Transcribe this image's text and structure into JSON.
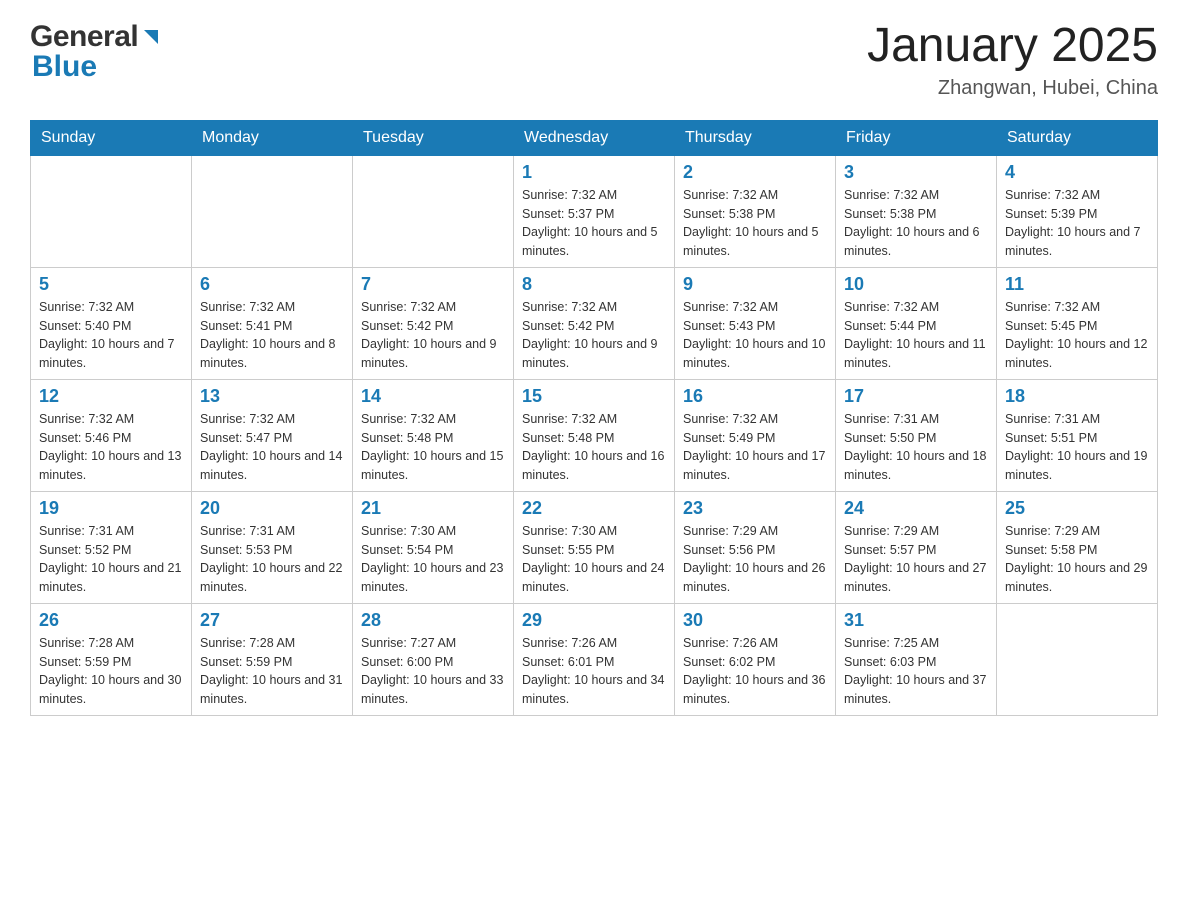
{
  "header": {
    "logo": {
      "general": "General",
      "blue": "Blue"
    },
    "title": "January 2025",
    "location": "Zhangwan, Hubei, China"
  },
  "calendar": {
    "days_of_week": [
      "Sunday",
      "Monday",
      "Tuesday",
      "Wednesday",
      "Thursday",
      "Friday",
      "Saturday"
    ],
    "weeks": [
      [
        {
          "day": "",
          "info": ""
        },
        {
          "day": "",
          "info": ""
        },
        {
          "day": "",
          "info": ""
        },
        {
          "day": "1",
          "info": "Sunrise: 7:32 AM\nSunset: 5:37 PM\nDaylight: 10 hours and 5 minutes."
        },
        {
          "day": "2",
          "info": "Sunrise: 7:32 AM\nSunset: 5:38 PM\nDaylight: 10 hours and 5 minutes."
        },
        {
          "day": "3",
          "info": "Sunrise: 7:32 AM\nSunset: 5:38 PM\nDaylight: 10 hours and 6 minutes."
        },
        {
          "day": "4",
          "info": "Sunrise: 7:32 AM\nSunset: 5:39 PM\nDaylight: 10 hours and 7 minutes."
        }
      ],
      [
        {
          "day": "5",
          "info": "Sunrise: 7:32 AM\nSunset: 5:40 PM\nDaylight: 10 hours and 7 minutes."
        },
        {
          "day": "6",
          "info": "Sunrise: 7:32 AM\nSunset: 5:41 PM\nDaylight: 10 hours and 8 minutes."
        },
        {
          "day": "7",
          "info": "Sunrise: 7:32 AM\nSunset: 5:42 PM\nDaylight: 10 hours and 9 minutes."
        },
        {
          "day": "8",
          "info": "Sunrise: 7:32 AM\nSunset: 5:42 PM\nDaylight: 10 hours and 9 minutes."
        },
        {
          "day": "9",
          "info": "Sunrise: 7:32 AM\nSunset: 5:43 PM\nDaylight: 10 hours and 10 minutes."
        },
        {
          "day": "10",
          "info": "Sunrise: 7:32 AM\nSunset: 5:44 PM\nDaylight: 10 hours and 11 minutes."
        },
        {
          "day": "11",
          "info": "Sunrise: 7:32 AM\nSunset: 5:45 PM\nDaylight: 10 hours and 12 minutes."
        }
      ],
      [
        {
          "day": "12",
          "info": "Sunrise: 7:32 AM\nSunset: 5:46 PM\nDaylight: 10 hours and 13 minutes."
        },
        {
          "day": "13",
          "info": "Sunrise: 7:32 AM\nSunset: 5:47 PM\nDaylight: 10 hours and 14 minutes."
        },
        {
          "day": "14",
          "info": "Sunrise: 7:32 AM\nSunset: 5:48 PM\nDaylight: 10 hours and 15 minutes."
        },
        {
          "day": "15",
          "info": "Sunrise: 7:32 AM\nSunset: 5:48 PM\nDaylight: 10 hours and 16 minutes."
        },
        {
          "day": "16",
          "info": "Sunrise: 7:32 AM\nSunset: 5:49 PM\nDaylight: 10 hours and 17 minutes."
        },
        {
          "day": "17",
          "info": "Sunrise: 7:31 AM\nSunset: 5:50 PM\nDaylight: 10 hours and 18 minutes."
        },
        {
          "day": "18",
          "info": "Sunrise: 7:31 AM\nSunset: 5:51 PM\nDaylight: 10 hours and 19 minutes."
        }
      ],
      [
        {
          "day": "19",
          "info": "Sunrise: 7:31 AM\nSunset: 5:52 PM\nDaylight: 10 hours and 21 minutes."
        },
        {
          "day": "20",
          "info": "Sunrise: 7:31 AM\nSunset: 5:53 PM\nDaylight: 10 hours and 22 minutes."
        },
        {
          "day": "21",
          "info": "Sunrise: 7:30 AM\nSunset: 5:54 PM\nDaylight: 10 hours and 23 minutes."
        },
        {
          "day": "22",
          "info": "Sunrise: 7:30 AM\nSunset: 5:55 PM\nDaylight: 10 hours and 24 minutes."
        },
        {
          "day": "23",
          "info": "Sunrise: 7:29 AM\nSunset: 5:56 PM\nDaylight: 10 hours and 26 minutes."
        },
        {
          "day": "24",
          "info": "Sunrise: 7:29 AM\nSunset: 5:57 PM\nDaylight: 10 hours and 27 minutes."
        },
        {
          "day": "25",
          "info": "Sunrise: 7:29 AM\nSunset: 5:58 PM\nDaylight: 10 hours and 29 minutes."
        }
      ],
      [
        {
          "day": "26",
          "info": "Sunrise: 7:28 AM\nSunset: 5:59 PM\nDaylight: 10 hours and 30 minutes."
        },
        {
          "day": "27",
          "info": "Sunrise: 7:28 AM\nSunset: 5:59 PM\nDaylight: 10 hours and 31 minutes."
        },
        {
          "day": "28",
          "info": "Sunrise: 7:27 AM\nSunset: 6:00 PM\nDaylight: 10 hours and 33 minutes."
        },
        {
          "day": "29",
          "info": "Sunrise: 7:26 AM\nSunset: 6:01 PM\nDaylight: 10 hours and 34 minutes."
        },
        {
          "day": "30",
          "info": "Sunrise: 7:26 AM\nSunset: 6:02 PM\nDaylight: 10 hours and 36 minutes."
        },
        {
          "day": "31",
          "info": "Sunrise: 7:25 AM\nSunset: 6:03 PM\nDaylight: 10 hours and 37 minutes."
        },
        {
          "day": "",
          "info": ""
        }
      ]
    ]
  }
}
